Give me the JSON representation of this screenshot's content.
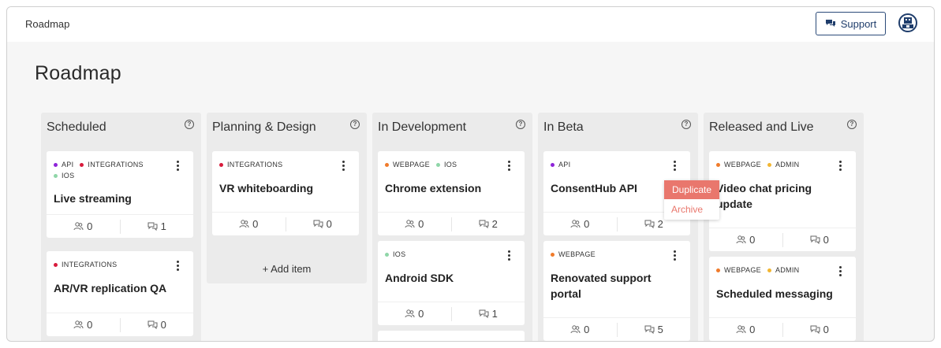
{
  "header": {
    "breadcrumb": "Roadmap",
    "support_label": "Support",
    "avatar_icon": "user-avatar-icon"
  },
  "page_title": "Roadmap",
  "colors": {
    "accent": "#1f3d6b",
    "menu_highlight": "#e9776d",
    "tag_api": "#8e24d8",
    "tag_integrations": "#d81b3c",
    "tag_ios": "#8fd6a8",
    "tag_webpage": "#f07b2b",
    "tag_admin": "#f2b632"
  },
  "columns": [
    {
      "title": "Scheduled",
      "cards": [
        {
          "tags": [
            {
              "label": "API",
              "color": "#8e24d8"
            },
            {
              "label": "INTEGRATIONS",
              "color": "#d81b3c"
            },
            {
              "label": "IOS",
              "color": "#8fd6a8"
            }
          ],
          "title": "Live streaming",
          "users": "0",
          "comments": "1"
        },
        {
          "tags": [
            {
              "label": "INTEGRATIONS",
              "color": "#d81b3c"
            }
          ],
          "title": "AR/VR replication QA",
          "users": "0",
          "comments": "0"
        }
      ]
    },
    {
      "title": "Planning & Design",
      "cards": [
        {
          "tags": [
            {
              "label": "INTEGRATIONS",
              "color": "#d81b3c"
            }
          ],
          "title": "VR whiteboarding",
          "users": "0",
          "comments": "0"
        }
      ],
      "add_item": "+ Add item"
    },
    {
      "title": "In Development",
      "cards": [
        {
          "tags": [
            {
              "label": "WEBPAGE",
              "color": "#f07b2b"
            },
            {
              "label": "IOS",
              "color": "#8fd6a8"
            }
          ],
          "title": "Chrome extension",
          "users": "0",
          "comments": "2"
        },
        {
          "tags": [
            {
              "label": "IOS",
              "color": "#8fd6a8"
            }
          ],
          "title": "Android SDK",
          "users": "0",
          "comments": "1"
        }
      ]
    },
    {
      "title": "In Beta",
      "cards": [
        {
          "tags": [
            {
              "label": "API",
              "color": "#8e24d8"
            }
          ],
          "title": "ConsentHub API",
          "users": "0",
          "comments": "2"
        },
        {
          "tags": [
            {
              "label": "WEBPAGE",
              "color": "#f07b2b"
            }
          ],
          "title": "Renovated support portal",
          "users": "0",
          "comments": "5"
        }
      ]
    },
    {
      "title": "Released and Live",
      "cards": [
        {
          "tags": [
            {
              "label": "WEBPAGE",
              "color": "#f07b2b"
            },
            {
              "label": "ADMIN",
              "color": "#f2b632"
            }
          ],
          "title": "Video chat pricing update",
          "users": "0",
          "comments": "0"
        },
        {
          "tags": [
            {
              "label": "WEBPAGE",
              "color": "#f07b2b"
            },
            {
              "label": "ADMIN",
              "color": "#f2b632"
            }
          ],
          "title": "Scheduled messaging",
          "users": "0",
          "comments": "0"
        }
      ]
    }
  ],
  "context_menu": {
    "duplicate": "Duplicate",
    "archive": "Archive"
  }
}
